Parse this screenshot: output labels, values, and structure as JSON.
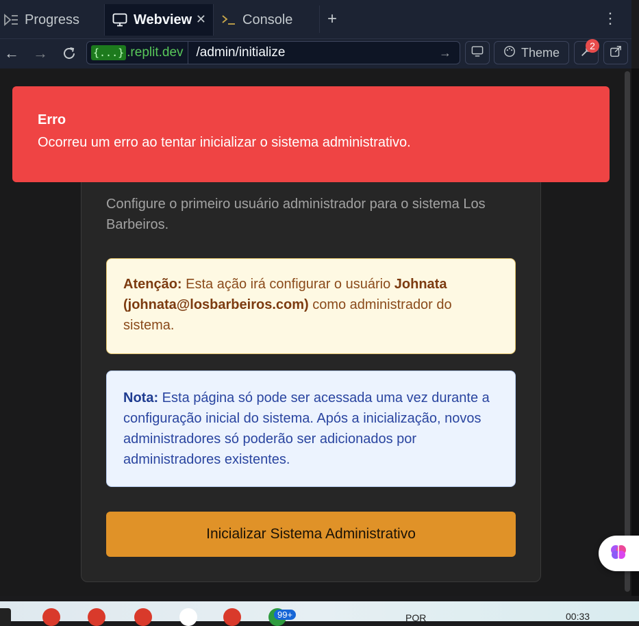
{
  "tabs": {
    "progress": "Progress",
    "webview": "Webview",
    "console": "Console"
  },
  "address": {
    "badge": "{...}",
    "host": ".replit.dev",
    "path": "/admin/initialize"
  },
  "toolbar": {
    "theme_label": "Theme",
    "devtools_badge": "2"
  },
  "toast": {
    "title": "Erro",
    "message": "Ocorreu um erro ao tentar inicializar o sistema administrativo."
  },
  "card": {
    "subtitle": "Configure o primeiro usuário administrador para o sistema Los Barbeiros.",
    "warning": {
      "label": "Atenção:",
      "text_before": "Esta ação irá configurar o usuário",
      "user": "Johnata (johnata@losbarbeiros.com)",
      "text_after": "como administrador do sistema."
    },
    "note": {
      "label": "Nota:",
      "text": "Esta página só pode ser acessada uma vez durante a configuração inicial do sistema. Após a inicialização, novos administradores só poderão ser adicionados por administradores existentes."
    },
    "button_label": "Inicializar Sistema Administrativo"
  },
  "taskbar": {
    "notification_count": "99+",
    "language": "POR",
    "time": "00:33"
  },
  "colors": {
    "toast_bg": "#ef4444",
    "primary_button": "#e09228",
    "warning_bg": "#fef9e3",
    "note_bg": "#ecf3fe"
  }
}
